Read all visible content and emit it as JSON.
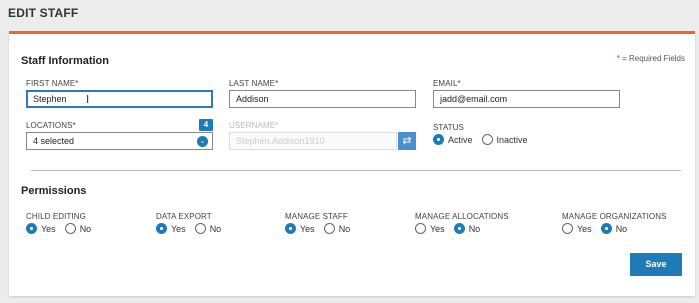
{
  "page": {
    "title": "EDIT STAFF"
  },
  "staff_info": {
    "heading": "Staff Information",
    "required_star": "*",
    "required_text": " = Required Fields",
    "first_name": {
      "label": "FIRST NAME*",
      "value": "Stephen"
    },
    "last_name": {
      "label": "LAST NAME*",
      "value": "Addison"
    },
    "email": {
      "label": "EMAIL*",
      "value": "jadd@email.com"
    },
    "locations": {
      "label": "LOCATIONS*",
      "count": "4",
      "value": "4 selected"
    },
    "username": {
      "label": "USERNAME*",
      "value": "Stephen.Addison1910"
    },
    "status": {
      "label": "STATUS",
      "options": [
        {
          "label": "Active",
          "checked": true
        },
        {
          "label": "Inactive",
          "checked": false
        }
      ]
    }
  },
  "permissions": {
    "heading": "Permissions",
    "items": [
      {
        "label": "CHILD EDITING",
        "yes": "Yes",
        "no": "No",
        "selected": "yes"
      },
      {
        "label": "DATA EXPORT",
        "yes": "Yes",
        "no": "No",
        "selected": "yes"
      },
      {
        "label": "MANAGE STAFF",
        "yes": "Yes",
        "no": "No",
        "selected": "yes"
      },
      {
        "label": "MANAGE ALLOCATIONS",
        "yes": "Yes",
        "no": "No",
        "selected": "no"
      },
      {
        "label": "MANAGE ORGANIZATIONS",
        "yes": "Yes",
        "no": "No",
        "selected": "no"
      }
    ]
  },
  "actions": {
    "save_label": "Save"
  },
  "colors": {
    "accent": "#e8692e",
    "primary": "#1f7bb8",
    "required": "#d9301c"
  },
  "icons": {
    "chevron": "chevron-down-icon",
    "shuffle": "shuffle-icon",
    "cursor": "text-cursor-icon"
  }
}
